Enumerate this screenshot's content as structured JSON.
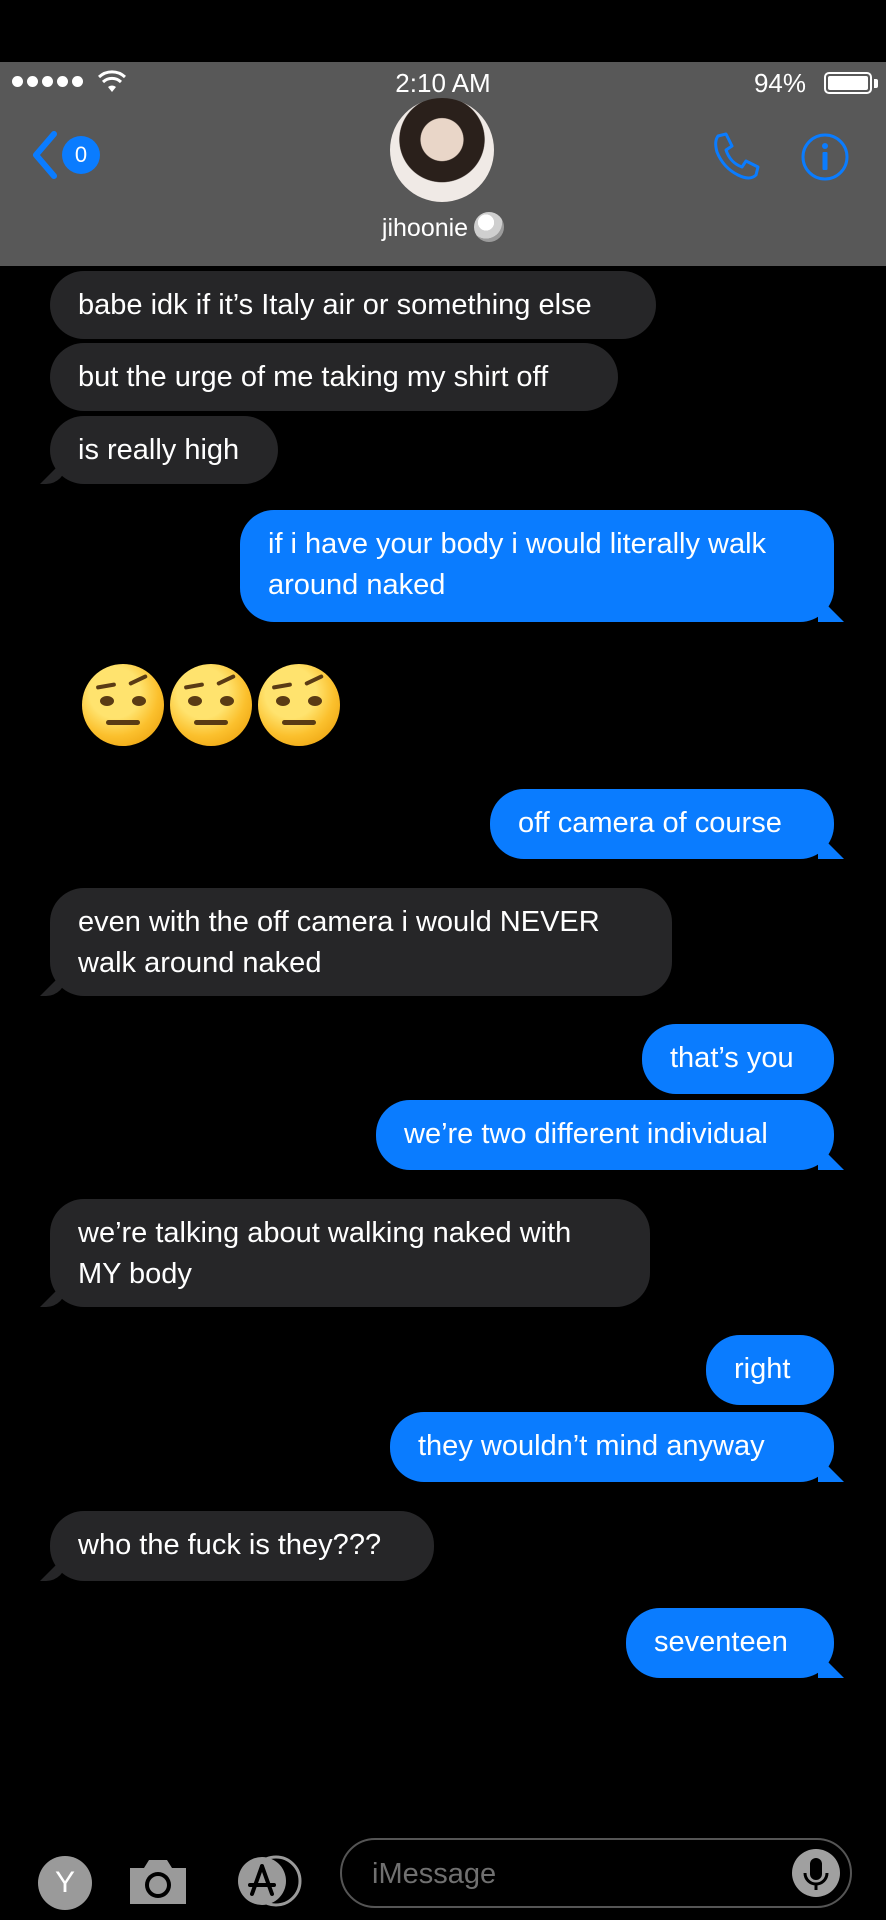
{
  "status_bar": {
    "time": "2:10 AM",
    "battery": "94%",
    "battery_level": 0.94,
    "signal_bars": 5
  },
  "header": {
    "back_badge": "0",
    "contact_name": "jihoonie",
    "icons": [
      "chevron-left-icon",
      "phone-icon",
      "info-icon"
    ],
    "accent": "#0a7cff"
  },
  "messages": [
    {
      "from": "them",
      "text": "babe idk if it’s Italy air or something else"
    },
    {
      "from": "them",
      "text": "but the urge of me taking my shirt off"
    },
    {
      "from": "them",
      "text": "is really high"
    },
    {
      "from": "me",
      "text": "if i have your body i would literally walk\naround naked"
    },
    {
      "from": "them",
      "emoji": "face-with-raised-eyebrow x3"
    },
    {
      "from": "me",
      "text": "off camera of course"
    },
    {
      "from": "them",
      "text": "even with the off camera i would NEVER\nwalk around naked"
    },
    {
      "from": "me",
      "text": "that’s you"
    },
    {
      "from": "me",
      "text": "we’re two different individual"
    },
    {
      "from": "them",
      "text": "we’re talking about walking naked with\nMY body"
    },
    {
      "from": "me",
      "text": "right"
    },
    {
      "from": "me",
      "text": "they wouldn’t mind anyway"
    },
    {
      "from": "them",
      "text": "who the fuck is they???"
    },
    {
      "from": "me",
      "text": "seventeen"
    }
  ],
  "toolbar": {
    "y_label": "Y",
    "placeholder": "iMessage",
    "icons": [
      "camera-icon",
      "app-store-icon",
      "mic-icon"
    ]
  },
  "colors": {
    "sent_bubble": "#0a7cff",
    "received_bubble": "#262628",
    "header_bg": "#585858",
    "background": "#000000"
  }
}
